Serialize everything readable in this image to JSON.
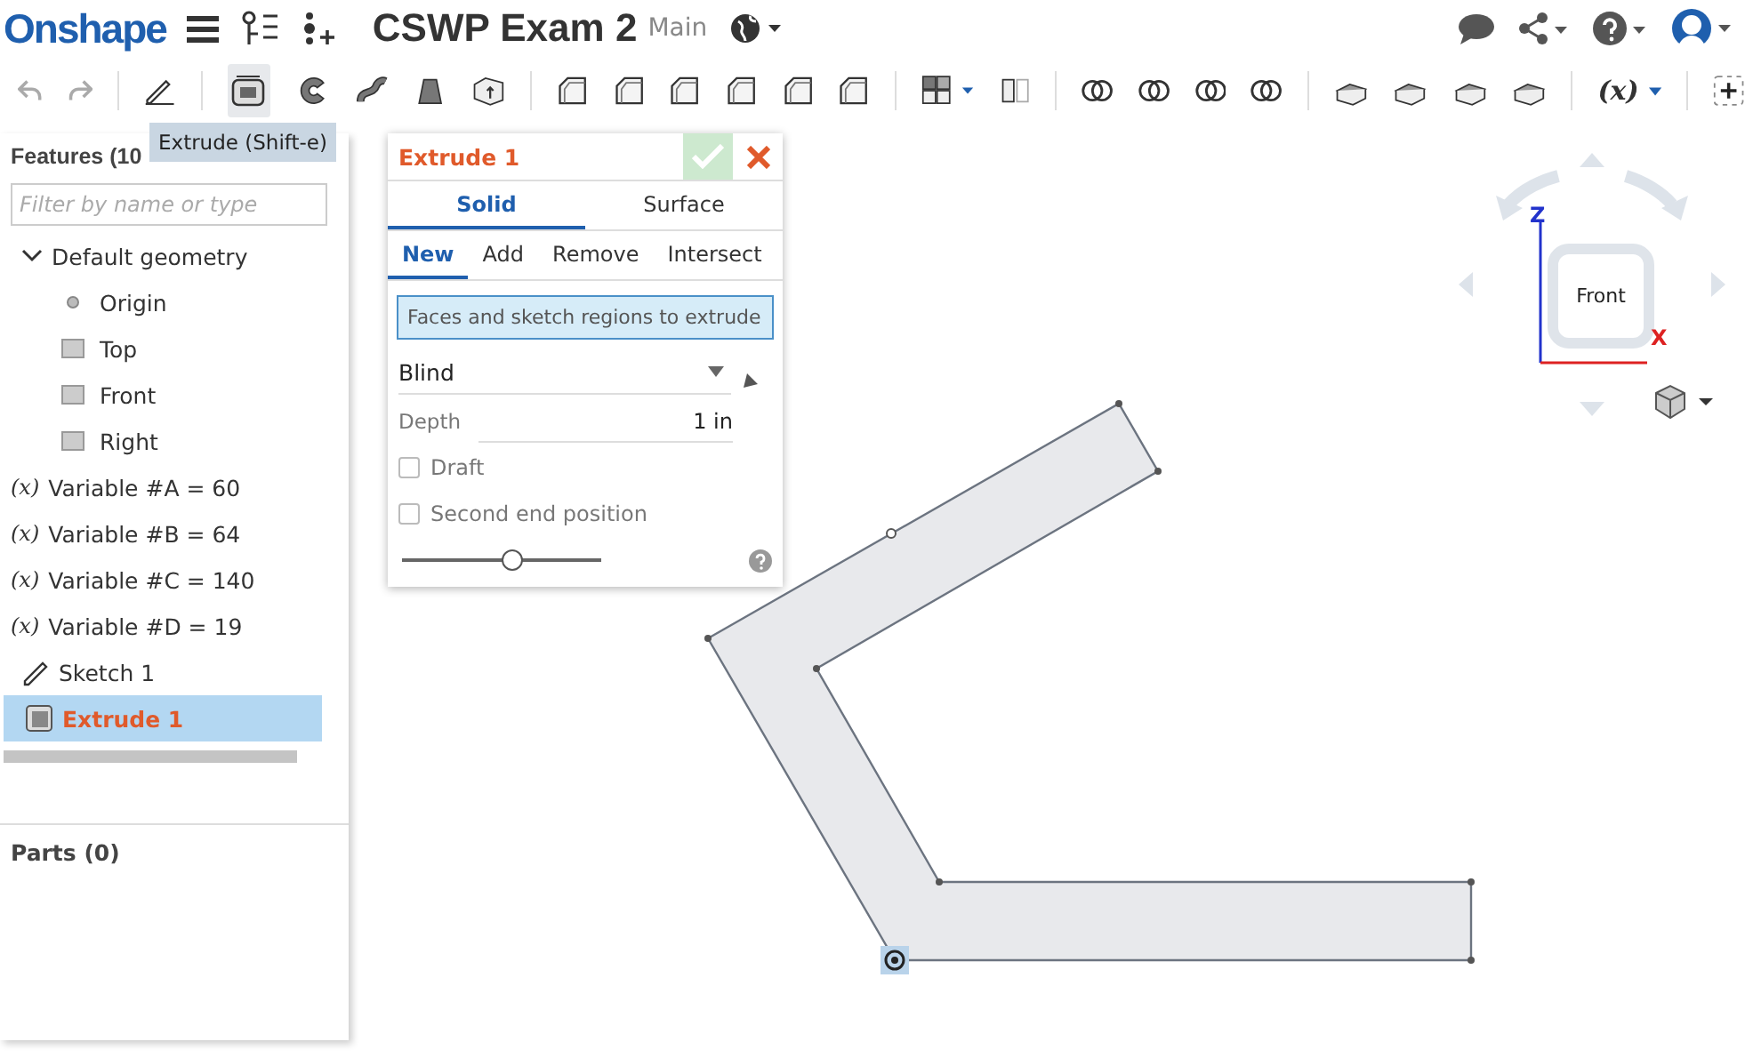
{
  "header": {
    "logo": "Onshape",
    "title": "CSWP Exam 2",
    "branch": "Main"
  },
  "toolbar": {
    "variable_tool": "(x)"
  },
  "tooltip": "Extrude (Shift-e)",
  "feature_panel": {
    "title": "Features (10",
    "filter_placeholder": "Filter by name or type",
    "tree": [
      {
        "label": "Default geometry",
        "kind": "group",
        "expanded": true,
        "selected": false,
        "children": [
          {
            "label": "Origin",
            "kind": "origin",
            "selected": false
          },
          {
            "label": "Top",
            "kind": "plane",
            "selected": false
          },
          {
            "label": "Front",
            "kind": "plane",
            "selected": false
          },
          {
            "label": "Right",
            "kind": "plane",
            "selected": false
          }
        ]
      },
      {
        "label": "Variable #A = 60",
        "kind": "variable",
        "prefix": "(x)",
        "selected": false
      },
      {
        "label": "Variable #B = 64",
        "kind": "variable",
        "prefix": "(x)",
        "selected": false
      },
      {
        "label": "Variable #C = 140",
        "kind": "variable",
        "prefix": "(x)",
        "selected": false
      },
      {
        "label": "Variable #D = 19",
        "kind": "variable",
        "prefix": "(x)",
        "selected": false
      },
      {
        "label": "Sketch 1",
        "kind": "sketch",
        "selected": false
      },
      {
        "label": "Extrude 1",
        "kind": "extrude",
        "selected": true
      }
    ],
    "parts": "Parts (0)"
  },
  "dialog": {
    "title": "Extrude 1",
    "body_tabs": [
      {
        "label": "Solid",
        "selected": true
      },
      {
        "label": "Surface",
        "selected": false
      }
    ],
    "operation_tabs": [
      {
        "label": "New",
        "selected": true
      },
      {
        "label": "Add",
        "selected": false
      },
      {
        "label": "Remove",
        "selected": false
      },
      {
        "label": "Intersect",
        "selected": false
      }
    ],
    "selection_field": {
      "placeholder": "Faces and sketch regions to extrude"
    },
    "end_type": "Blind",
    "depth": {
      "label": "Depth",
      "value": "1 in"
    },
    "checkboxes": [
      {
        "label": "Draft",
        "checked": false
      },
      {
        "label": "Second end position",
        "checked": false
      }
    ],
    "slider": {
      "level": 0.55
    }
  },
  "view_cube": {
    "face": "Front",
    "z_axis": "Z",
    "x_axis": "X"
  }
}
